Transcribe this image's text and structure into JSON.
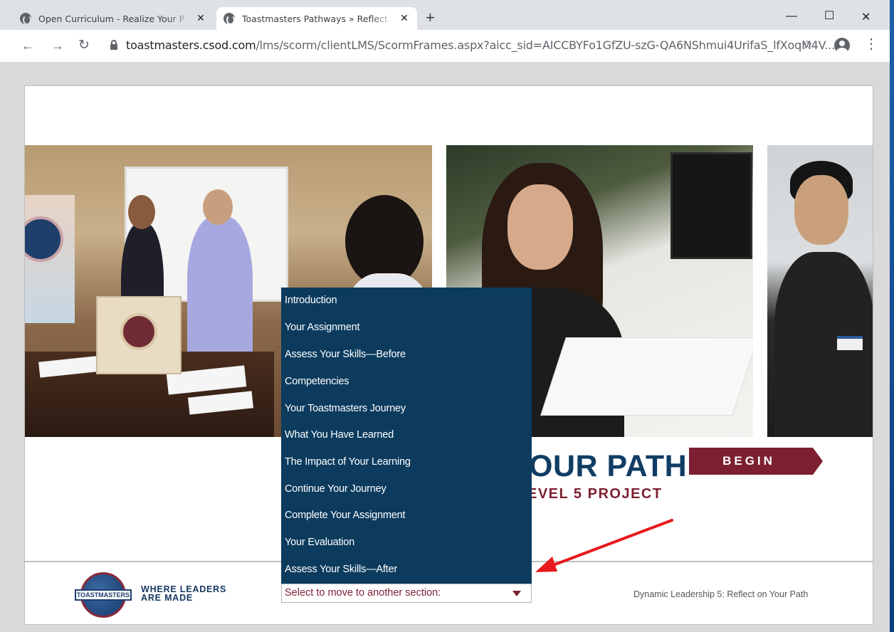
{
  "browser": {
    "tabs": [
      {
        "title": "Open Curriculum - Realize Your P",
        "active": false
      },
      {
        "title": "Toastmasters Pathways » Reflect",
        "active": true
      }
    ],
    "url_domain": "toastmasters.csod.com",
    "url_path": "/lms/scorm/clientLMS/ScormFrames.aspx?aicc_sid=AICCBYFo1GfZU-szG-QA6NShmui4UrifaS_lfXoqM4V..."
  },
  "course": {
    "title_visible": "OUR PATH",
    "subtitle_visible": "EVEL 5 PROJECT",
    "begin_label": "BEGIN"
  },
  "section_menu": {
    "items": [
      "Introduction",
      "Your Assignment",
      "Assess Your Skills—Before",
      "Competencies",
      "Your Toastmasters Journey",
      "What You Have Learned",
      "The Impact of Your Learning",
      "Continue Your Journey",
      "Complete Your Assignment",
      "Your Evaluation",
      "Assess Your Skills—After"
    ],
    "select_placeholder": "Select to move to another section:"
  },
  "footer": {
    "logo_text": "TOASTMASTERS",
    "tagline_line1": "WHERE LEADERS",
    "tagline_line2": "ARE MADE",
    "project_name": "Dynamic Leadership 5: Reflect on Your Path"
  },
  "colors": {
    "navy": "#0c3b5e",
    "maroon": "#7c1f31",
    "annotation": "#e8191c"
  }
}
